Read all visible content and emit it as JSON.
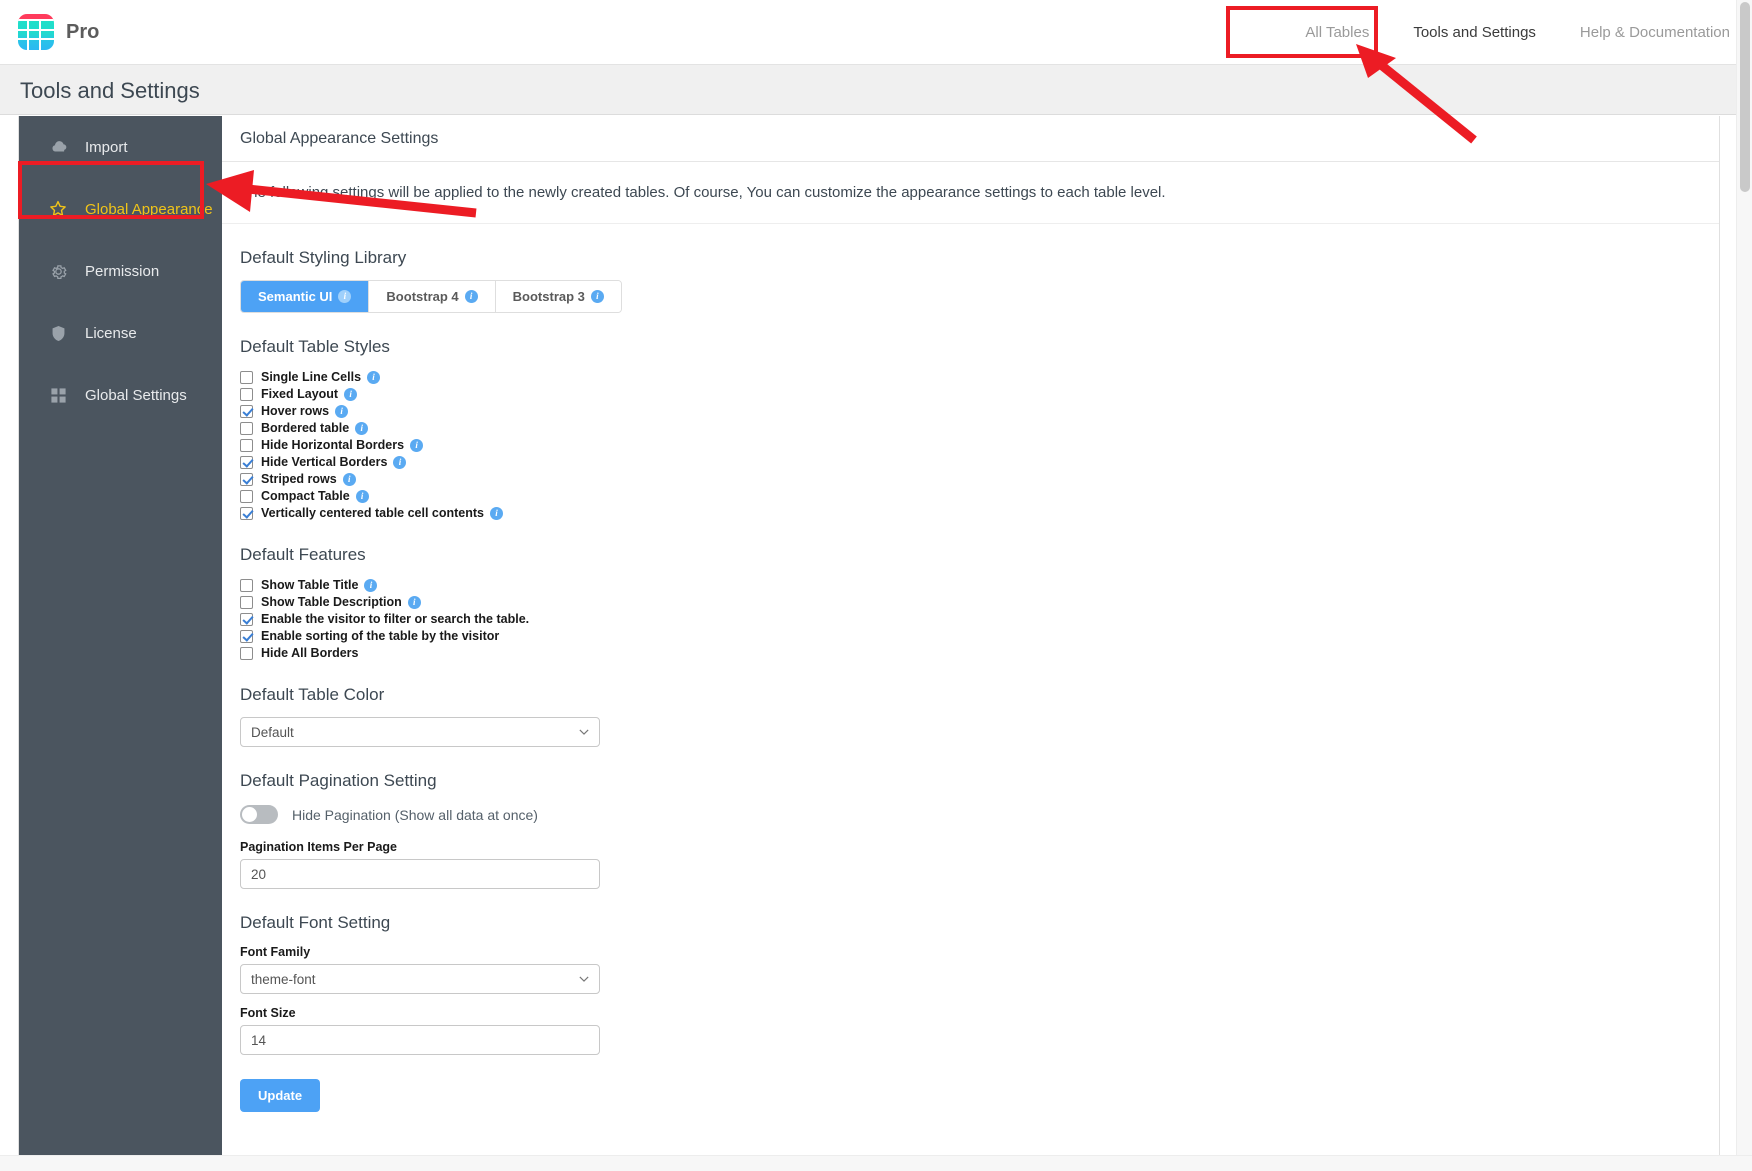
{
  "app": {
    "brand_name": "Pro",
    "brand_logo_icon": "table-logo-icon"
  },
  "topnav": {
    "items": [
      {
        "label": "All Tables",
        "active": false
      },
      {
        "label": "Tools and Settings",
        "active": true
      },
      {
        "label": "Help & Documentation",
        "active": false
      }
    ]
  },
  "page": {
    "title": "Tools and Settings"
  },
  "sidebar": {
    "items": [
      {
        "label": "Import",
        "icon": "cloud-upload-icon",
        "active": false
      },
      {
        "label": "Global Appearance",
        "icon": "star-icon",
        "active": true
      },
      {
        "label": "Permission",
        "icon": "gear-icon",
        "active": false
      },
      {
        "label": "License",
        "icon": "shield-icon",
        "active": false
      },
      {
        "label": "Global Settings",
        "icon": "grid-icon",
        "active": false
      }
    ]
  },
  "main": {
    "heading": "Global Appearance Settings",
    "description": "The following settings will be applied to the newly created tables. Of course, You can customize the appearance settings to each table level.",
    "styling_library": {
      "title": "Default Styling Library",
      "options": [
        {
          "label": "Semantic UI",
          "info": true,
          "active": true
        },
        {
          "label": "Bootstrap 4",
          "info": true,
          "active": false
        },
        {
          "label": "Bootstrap 3",
          "info": true,
          "active": false
        }
      ]
    },
    "table_styles": {
      "title": "Default Table Styles",
      "items": [
        {
          "label": "Single Line Cells",
          "checked": false,
          "info": true
        },
        {
          "label": "Fixed Layout",
          "checked": false,
          "info": true
        },
        {
          "label": "Hover rows",
          "checked": true,
          "info": true
        },
        {
          "label": "Bordered table",
          "checked": false,
          "info": true
        },
        {
          "label": "Hide Horizontal Borders",
          "checked": false,
          "info": true
        },
        {
          "label": "Hide Vertical Borders",
          "checked": true,
          "info": true
        },
        {
          "label": "Striped rows",
          "checked": true,
          "info": true
        },
        {
          "label": "Compact Table",
          "checked": false,
          "info": true
        },
        {
          "label": "Vertically centered table cell contents",
          "checked": true,
          "info": true
        }
      ]
    },
    "features": {
      "title": "Default Features",
      "items": [
        {
          "label": "Show Table Title",
          "checked": false,
          "info": true
        },
        {
          "label": "Show Table Description",
          "checked": false,
          "info": true
        },
        {
          "label": "Enable the visitor to filter or search the table.",
          "checked": true,
          "info": false
        },
        {
          "label": "Enable sorting of the table by the visitor",
          "checked": true,
          "info": false
        },
        {
          "label": "Hide All Borders",
          "checked": false,
          "info": false
        }
      ]
    },
    "table_color": {
      "title": "Default Table Color",
      "value": "Default"
    },
    "pagination": {
      "title": "Default Pagination Setting",
      "toggle_label": "Hide Pagination (Show all data at once)",
      "toggle_on": false,
      "items_per_page_label": "Pagination Items Per Page",
      "items_per_page_value": "20"
    },
    "font": {
      "title": "Default Font Setting",
      "family_label": "Font Family",
      "family_value": "theme-font",
      "size_label": "Font Size",
      "size_value": "14"
    },
    "update_button": "Update"
  },
  "colors": {
    "accent_blue": "#4da2f5",
    "sidebar_bg": "#4b555f",
    "sidebar_active_text": "#f0c419",
    "annotation_red": "#ec1c24"
  }
}
